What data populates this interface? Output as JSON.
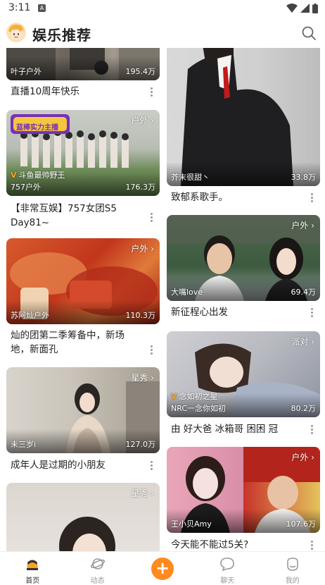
{
  "status_bar": {
    "time": "3:11",
    "notif": "A"
  },
  "header": {
    "title": "娱乐推荐"
  },
  "feed": {
    "left": [
      {
        "streamer": "叶子户外",
        "viewers": "195.4万",
        "caption": "直播10周年快乐",
        "category": ""
      },
      {
        "streamer": "757户外",
        "viewers": "176.3万",
        "caption": "【非常互娱】757女团S5 Day81~",
        "category": "户外 ›",
        "tag": "斗鱼最帅野王",
        "banner": "蓝棒实力主播"
      },
      {
        "streamer": "苏阿灿户外",
        "viewers": "110.3万",
        "caption": "灿的团第二季筹备中，新场地，新面孔",
        "category": "户外 ›"
      },
      {
        "streamer": "未三岁i",
        "viewers": "127.0万",
        "caption": "成年人是过期的小朋友",
        "category": "星秀 ›"
      },
      {
        "streamer": "",
        "viewers": "",
        "caption": "",
        "category": "星秀 ›"
      }
    ],
    "right": [
      {
        "streamer": "芥末很甜丶",
        "viewers": "33.8万",
        "caption": "致郁系歌手。",
        "category": ""
      },
      {
        "streamer": "大嘴love",
        "viewers": "69.4万",
        "caption": "新征程心出发",
        "category": "户外 ›"
      },
      {
        "streamer": "NRC一念你如初",
        "viewers": "80.2万",
        "caption": "由 好大爸 冰箱哥 困困 冠",
        "category": "派对 ›",
        "tag": "念如初之星"
      },
      {
        "streamer": "王小贝Amy",
        "viewers": "107.6万",
        "caption": "今天能不能过5关?",
        "category": "户外 ›"
      }
    ]
  },
  "bottom_nav": [
    {
      "label": "首页",
      "icon": "home-icon",
      "active": true
    },
    {
      "label": "动态",
      "icon": "planet-icon",
      "active": false
    },
    {
      "label": "",
      "icon": "plus-icon",
      "active": false
    },
    {
      "label": "聊天",
      "icon": "chat-bubble-icon",
      "active": false
    },
    {
      "label": "我的",
      "icon": "profile-icon",
      "active": false
    }
  ],
  "colors": {
    "accent": "#ff8a1f",
    "text": "#222222",
    "muted": "#999999"
  }
}
